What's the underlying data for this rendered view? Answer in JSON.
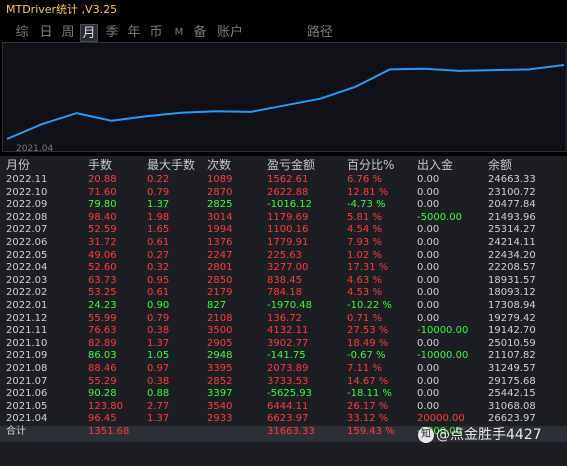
{
  "app": {
    "title": "MTDriver统计 ,V3.25"
  },
  "tabs": [
    {
      "label": "综",
      "active": false
    },
    {
      "label": "日",
      "active": false
    },
    {
      "label": "周",
      "active": false
    },
    {
      "label": "月",
      "active": true
    },
    {
      "label": "季",
      "active": false
    },
    {
      "label": "年",
      "active": false
    },
    {
      "label": "币",
      "active": false
    },
    {
      "label": "M",
      "active": false
    },
    {
      "label": "备",
      "active": false
    },
    {
      "label": "账户",
      "active": false
    },
    {
      "label": "路径",
      "active": false
    }
  ],
  "chart": {
    "start_label": "2021.04",
    "line_color": "#1e9fff",
    "series": [
      21107.82,
      23125.26,
      24642.71,
      23600.0,
      24200.0,
      24700.0,
      24900.0,
      24800.0,
      25700.0,
      26600.0,
      28200.0,
      30600.0,
      30700.0,
      30400.0,
      30500.0,
      30600.0,
      31200.0
    ]
  },
  "table": {
    "headers": [
      "月份",
      "手数",
      "最大手数",
      "次数",
      "盈亏金额",
      "百分比%",
      "出入金",
      "余额"
    ],
    "rows": [
      [
        "2022.11",
        "20.88",
        "0.22",
        "1089",
        "1562.61",
        "6.76 %",
        "0.00",
        "24663.33",
        "red"
      ],
      [
        "2022.10",
        "71.60",
        "0.79",
        "2870",
        "2622.88",
        "12.81 %",
        "0.00",
        "23100.72",
        "red"
      ],
      [
        "2022.09",
        "79.80",
        "1.37",
        "2825",
        "-1016.12",
        "-4.73 %",
        "0.00",
        "20477.84",
        "green"
      ],
      [
        "2022.08",
        "98.40",
        "1.98",
        "3014",
        "1179.69",
        "5.81 %",
        "-5000.00",
        "21493.96",
        "red"
      ],
      [
        "2022.07",
        "52.59",
        "1.65",
        "1994",
        "1100.16",
        "4.54 %",
        "0.00",
        "25314.27",
        "red"
      ],
      [
        "2022.06",
        "31.72",
        "0.61",
        "1376",
        "1779.91",
        "7.93 %",
        "0.00",
        "24214.11",
        "red"
      ],
      [
        "2022.05",
        "49.06",
        "0.27",
        "2247",
        "225.63",
        "1.02 %",
        "0.00",
        "22434.20",
        "red"
      ],
      [
        "2022.04",
        "52.60",
        "0.32",
        "2801",
        "3277.00",
        "17.31 %",
        "0.00",
        "22208.57",
        "red"
      ],
      [
        "2022.03",
        "63.73",
        "0.95",
        "2850",
        "838.45",
        "4.63 %",
        "0.00",
        "18931.57",
        "red"
      ],
      [
        "2022.02",
        "53.25",
        "0.61",
        "2179",
        "784.18",
        "4.53 %",
        "0.00",
        "18093.12",
        "red"
      ],
      [
        "2022.01",
        "24.23",
        "0.90",
        "827",
        "-1970.48",
        "-10.22 %",
        "0.00",
        "17308.94",
        "green"
      ],
      [
        "2021.12",
        "55.99",
        "0.79",
        "2108",
        "136.72",
        "0.71 %",
        "0.00",
        "19279.42",
        "red"
      ],
      [
        "2021.11",
        "76.63",
        "0.38",
        "3500",
        "4132.11",
        "27.53 %",
        "-10000.00",
        "19142.70",
        "red"
      ],
      [
        "2021.10",
        "82.89",
        "1.37",
        "2905",
        "3902.77",
        "18.49 %",
        "0.00",
        "25010.59",
        "red"
      ],
      [
        "2021.09",
        "86.03",
        "1.05",
        "2948",
        "-141.75",
        "-0.67 %",
        "-10000.00",
        "21107.82",
        "green"
      ],
      [
        "2021.08",
        "88.46",
        "0.97",
        "3395",
        "2073.89",
        "7.11 %",
        "0.00",
        "31249.57",
        "red"
      ],
      [
        "2021.07",
        "55.29",
        "0.38",
        "2852",
        "3733.53",
        "14.67 %",
        "0.00",
        "29175.68",
        "red"
      ],
      [
        "2021.06",
        "90.28",
        "0.88",
        "3397",
        "-5625.93",
        "-18.11 %",
        "0.00",
        "25442.15",
        "green"
      ],
      [
        "2021.05",
        "123.80",
        "2.77",
        "3540",
        "6444.11",
        "26.17 %",
        "0.00",
        "31068.08",
        "red"
      ],
      [
        "2021.04",
        "96.45",
        "1.37",
        "2933",
        "6623.97",
        "33.12 %",
        "20000.00",
        "26623.97",
        "red"
      ]
    ],
    "total": [
      "合计",
      "1351.68",
      "",
      "",
      "31663.33",
      "159.43 %",
      "-7000.00",
      ""
    ]
  },
  "watermark": {
    "icon": "zhihu-icon",
    "text": "@点金胜手4427"
  }
}
